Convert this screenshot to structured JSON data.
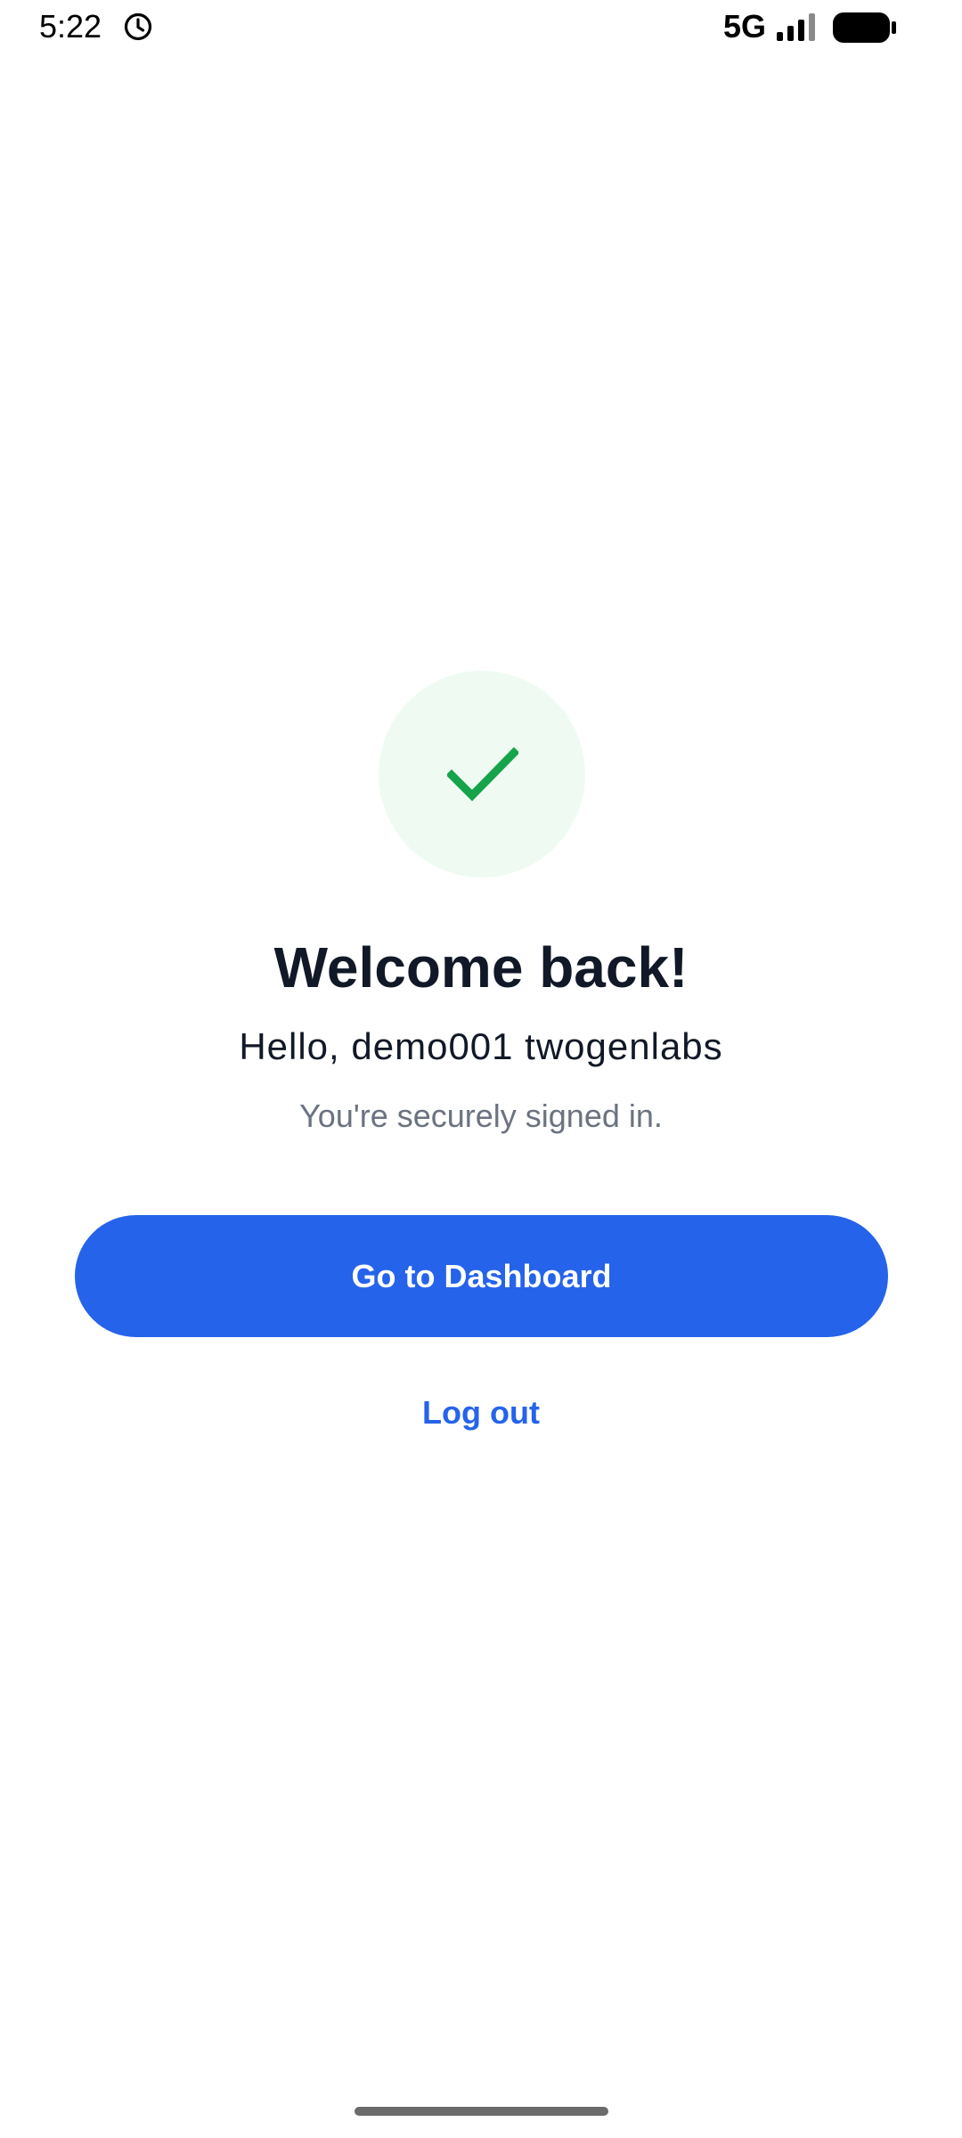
{
  "status_bar": {
    "time": "5:22",
    "network": "5G",
    "icons": [
      "alarm-icon",
      "signal-icon",
      "battery-icon"
    ]
  },
  "main": {
    "badge_icon": "check-icon",
    "title": "Welcome back!",
    "greeting": "Hello, demo001 twogenlabs",
    "note": "You're securely signed in.",
    "primary_button": "Go to Dashboard",
    "secondary_link": "Log out"
  },
  "colors": {
    "primary": "#2563eb",
    "success": "#16a34a",
    "success_bg": "#effbf2",
    "title_text": "#111827",
    "muted_text": "#6b7280"
  }
}
